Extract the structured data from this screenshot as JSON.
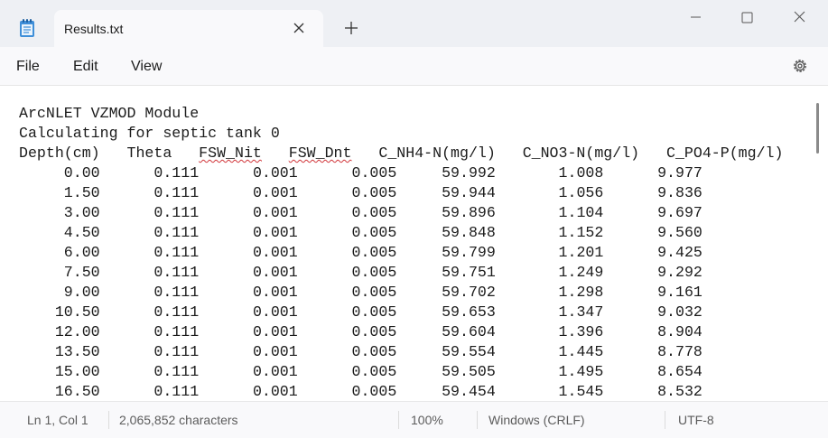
{
  "tab": {
    "title": "Results.txt"
  },
  "menu": {
    "file": "File",
    "edit": "Edit",
    "view": "View"
  },
  "editor": {
    "line_title": "ArcNLET VZMOD Module",
    "line_calc": "Calculating for septic tank 0",
    "header": {
      "depth": "Depth(cm)",
      "theta": "Theta",
      "fsw_nit": "FSW_Nit",
      "fsw_dnt": "FSW_Dnt",
      "nh4": "C_NH4-N(mg/l)",
      "no3": "C_NO3-N(mg/l)",
      "po4": "C_PO4-P(mg/l)"
    },
    "rows": [
      [
        "0.00",
        "0.111",
        "0.001",
        "0.005",
        "59.992",
        "1.008",
        "9.977"
      ],
      [
        "1.50",
        "0.111",
        "0.001",
        "0.005",
        "59.944",
        "1.056",
        "9.836"
      ],
      [
        "3.00",
        "0.111",
        "0.001",
        "0.005",
        "59.896",
        "1.104",
        "9.697"
      ],
      [
        "4.50",
        "0.111",
        "0.001",
        "0.005",
        "59.848",
        "1.152",
        "9.560"
      ],
      [
        "6.00",
        "0.111",
        "0.001",
        "0.005",
        "59.799",
        "1.201",
        "9.425"
      ],
      [
        "7.50",
        "0.111",
        "0.001",
        "0.005",
        "59.751",
        "1.249",
        "9.292"
      ],
      [
        "9.00",
        "0.111",
        "0.001",
        "0.005",
        "59.702",
        "1.298",
        "9.161"
      ],
      [
        "10.50",
        "0.111",
        "0.001",
        "0.005",
        "59.653",
        "1.347",
        "9.032"
      ],
      [
        "12.00",
        "0.111",
        "0.001",
        "0.005",
        "59.604",
        "1.396",
        "8.904"
      ],
      [
        "13.50",
        "0.111",
        "0.001",
        "0.005",
        "59.554",
        "1.445",
        "8.778"
      ],
      [
        "15.00",
        "0.111",
        "0.001",
        "0.005",
        "59.505",
        "1.495",
        "8.654"
      ],
      [
        "16.50",
        "0.111",
        "0.001",
        "0.005",
        "59.454",
        "1.545",
        "8.532"
      ]
    ]
  },
  "status": {
    "position": "Ln 1, Col 1",
    "characters": "2,065,852 characters",
    "zoom": "100%",
    "line_ending": "Windows (CRLF)",
    "encoding": "UTF-8"
  },
  "icons": {
    "app": "notepad-icon",
    "close_tab": "close-icon",
    "new_tab": "plus-icon",
    "minimize": "minimize-icon",
    "maximize": "maximize-icon",
    "close_window": "close-icon",
    "settings": "gear-icon"
  },
  "colors": {
    "titlebar": "#eef0f4",
    "accent": "#1a73e8",
    "spellcheck": "#d13438"
  }
}
